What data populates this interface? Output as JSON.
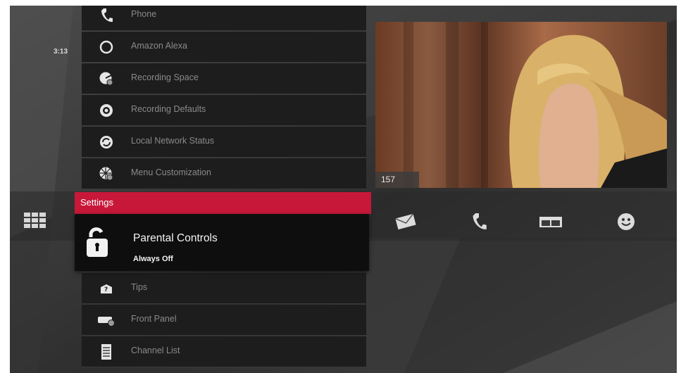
{
  "clock": {
    "time": "3:13"
  },
  "menu": {
    "items": [
      {
        "label": "Phone",
        "icon": "phone-icon"
      },
      {
        "label": "Amazon Alexa",
        "icon": "alexa-ring-icon"
      },
      {
        "label": "Recording Space",
        "icon": "recording-space-icon"
      },
      {
        "label": "Recording Defaults",
        "icon": "gear-icon"
      },
      {
        "label": "Local Network Status",
        "icon": "network-sync-icon"
      },
      {
        "label": "Menu Customization",
        "icon": "menu-customization-icon"
      }
    ],
    "section": "Settings",
    "selected": {
      "label": "Parental Controls",
      "sub": "Always Off",
      "icon": "unlocked-padlock-icon"
    },
    "items_after": [
      {
        "label": "Tips",
        "icon": "tips-icon"
      },
      {
        "label": "Front Panel",
        "icon": "front-panel-icon"
      },
      {
        "label": "Channel List",
        "icon": "channel-list-icon"
      }
    ]
  },
  "video": {
    "channel": "157"
  },
  "actions": [
    {
      "name": "mail-icon"
    },
    {
      "name": "phone-icon"
    },
    {
      "name": "window-icon"
    },
    {
      "name": "smiley-icon"
    }
  ],
  "colors": {
    "accent": "#c8183a",
    "menu_bg": "#1d1d1d",
    "selected_bg": "#0e0e0e"
  }
}
